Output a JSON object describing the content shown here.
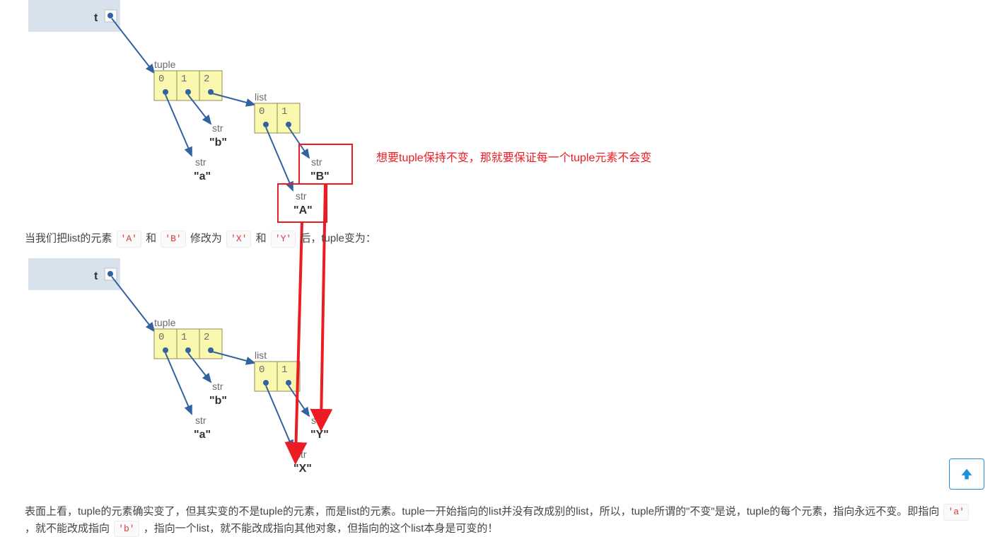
{
  "annotation": {
    "text": "想要tuple保持不变，那就要保证每一个tuple元素不会变"
  },
  "para1": {
    "t1": "当我们把list的元素",
    "codeA": "'A'",
    "t2": "和",
    "codeB": "'B'",
    "t3": "修改为",
    "codeX": "'X'",
    "t4": "和",
    "codeY": "'Y'",
    "t5": "后，tuple变为："
  },
  "para2": {
    "t1": "表面上看，tuple的元素确实变了，但其实变的不是tuple的元素，而是list的元素。tuple一开始指向的list并没有改成别的list，所以，tuple所谓的\"不变\"是说，tuple的每个元素，指向永远不变。即指向",
    "code_a": "'a'",
    "t2": "，就不能改成指向",
    "code_b": "'b'",
    "t3": "，指向一个list，就不能改成指向其他对象，但指向的这个list本身是可变的！"
  },
  "diagram1": {
    "var_t": "t",
    "tuple_label": "tuple",
    "list_label": "list",
    "str_label": "str",
    "idx0": "0",
    "idx1": "1",
    "idx2": "2",
    "val_a": "\"a\"",
    "val_b": "\"b\"",
    "val_A": "\"A\"",
    "val_B": "\"B\""
  },
  "diagram2": {
    "var_t": "t",
    "tuple_label": "tuple",
    "list_label": "list",
    "str_label": "str",
    "idx0": "0",
    "idx1": "1",
    "idx2": "2",
    "val_a": "\"a\"",
    "val_b": "\"b\"",
    "val_X": "\"X\"",
    "val_Y": "\"Y\""
  }
}
